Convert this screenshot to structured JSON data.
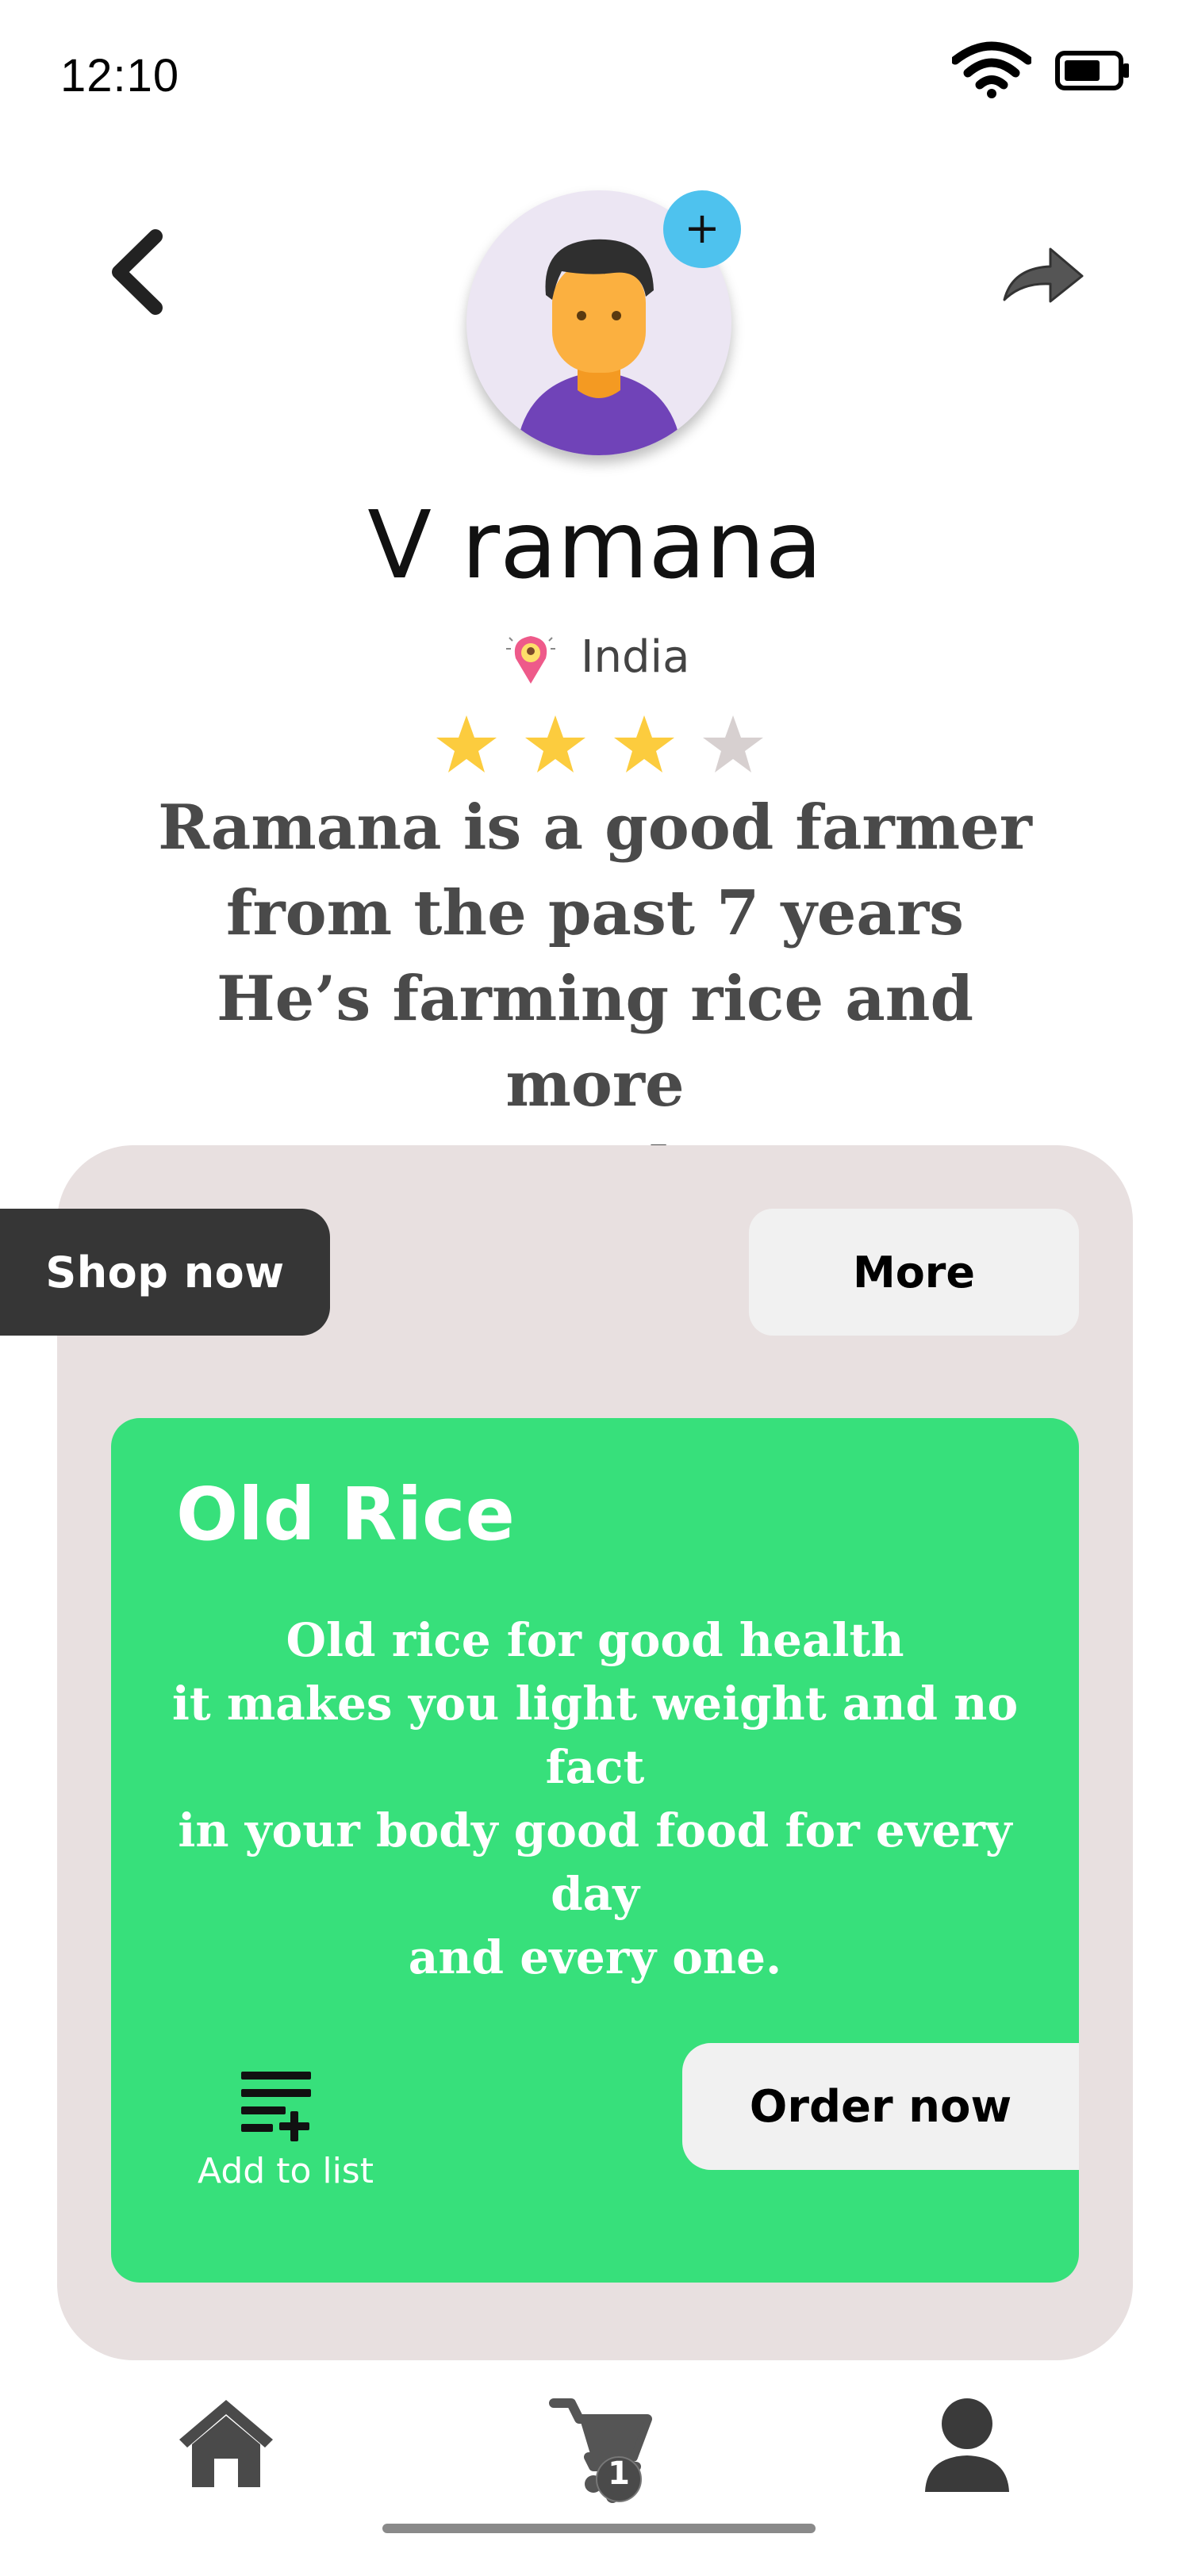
{
  "status_bar": {
    "time": "12:10",
    "icons": [
      "wifi-icon",
      "battery-icon"
    ]
  },
  "header": {
    "back_icon": "chevron-left-icon",
    "share_icon": "share-arrow-icon",
    "avatar_icon": "user-avatar",
    "avatar_add_label": "+"
  },
  "profile": {
    "name": "V ramana",
    "location_icon": "location-pin-icon",
    "location": "India",
    "rating": 3,
    "rating_max": 4,
    "bio": "Ramana is a good farmer\nfrom the past 7 years\nHe’s farming rice and more\nveg products"
  },
  "panel": {
    "shop_now_label": "Shop now",
    "more_label": "More",
    "product": {
      "title": "Old Rice",
      "description": "Old rice for good health\nit makes you light weight and no fact\nin your body good food for every day\nand every one.",
      "add_to_list_icon": "playlist-add-icon",
      "add_to_list_label": "Add to list",
      "order_label": "Order now"
    }
  },
  "bottom_nav": {
    "items": [
      {
        "icon": "home-icon"
      },
      {
        "icon": "cart-icon",
        "badge": "1"
      },
      {
        "icon": "profile-icon"
      }
    ]
  },
  "colors": {
    "accent_green": "#37e07b",
    "panel_bg": "#e8e0e0",
    "dark_button": "#363636",
    "star_filled": "#fccc3e",
    "star_empty": "#d7d0d0",
    "avatar_plus": "#4ec2ee"
  }
}
